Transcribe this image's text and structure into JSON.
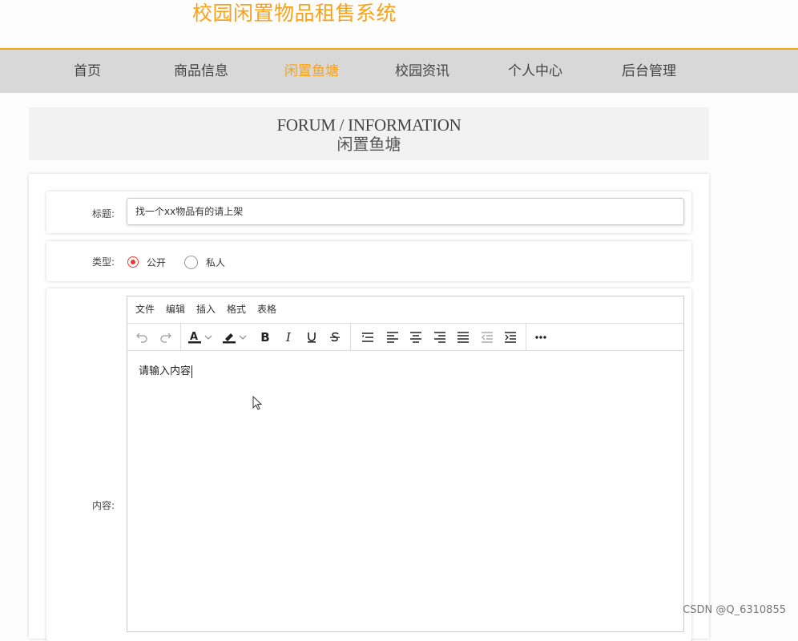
{
  "header": {
    "site_title": "校园闲置物品租售系统"
  },
  "nav": {
    "items": [
      {
        "label": "首页"
      },
      {
        "label": "商品信息"
      },
      {
        "label": "闲置鱼塘",
        "active": true
      },
      {
        "label": "校园资讯"
      },
      {
        "label": "个人中心"
      },
      {
        "label": "后台管理"
      }
    ]
  },
  "banner": {
    "title_en": "FORUM / INFORMATION",
    "title_cn": "闲置鱼塘"
  },
  "form": {
    "title_label": "标题:",
    "title_value": "找一个xx物品有的请上架",
    "type_label": "类型:",
    "type_options": [
      {
        "label": "公开",
        "checked": true
      },
      {
        "label": "私人",
        "checked": false
      }
    ],
    "content_label": "内容:"
  },
  "editor": {
    "menu": [
      "文件",
      "编辑",
      "插入",
      "格式",
      "表格"
    ],
    "toolbar_icons": [
      "undo-icon",
      "redo-icon",
      "font-color-icon",
      "highlight-color-icon",
      "bold-icon",
      "italic-icon",
      "underline-icon",
      "strikethrough-icon",
      "line-height-icon",
      "align-left-icon",
      "align-center-icon",
      "align-right-icon",
      "align-justify-icon",
      "outdent-icon",
      "indent-icon",
      "more-icon"
    ],
    "toolbar_text": {
      "bold": "B",
      "italic": "I",
      "font_color": "A"
    },
    "placeholder": "请输入内容"
  },
  "watermark": "CSDN @Q_6310855",
  "colors": {
    "accent": "#f7a21b",
    "nav_bg": "#d8d8d8",
    "radio_checked": "#e03c31"
  }
}
